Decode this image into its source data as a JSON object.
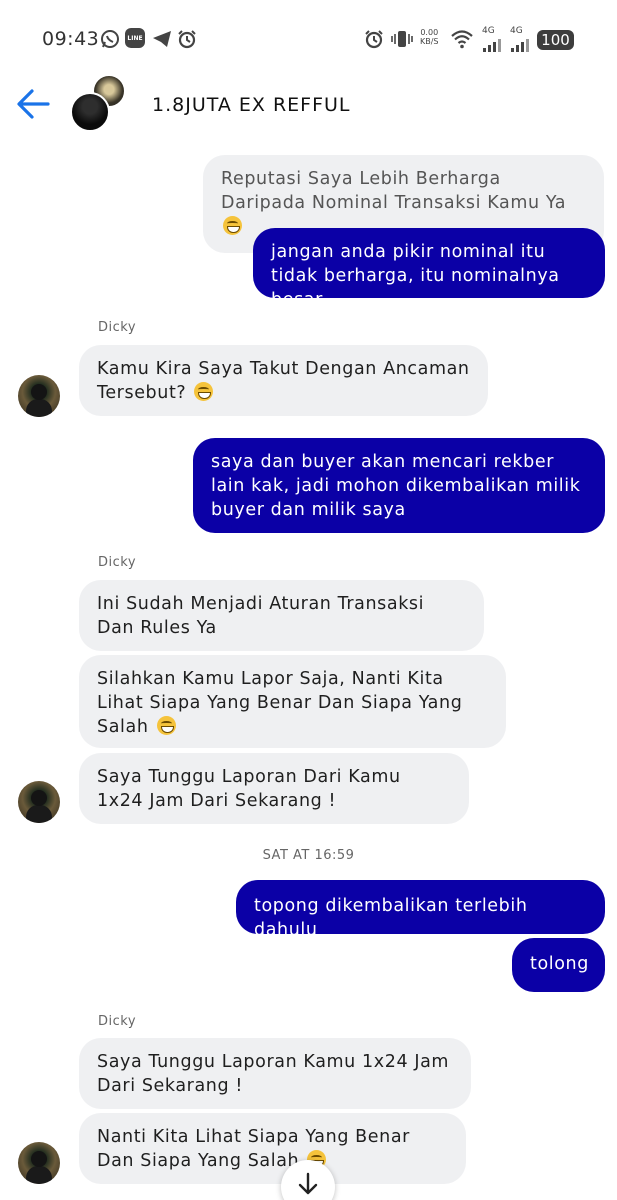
{
  "status_bar": {
    "time": "09:43",
    "battery": "100",
    "net_speed_value": "0.00",
    "net_speed_unit": "KB/S",
    "network_1": "4G",
    "network_2": "4G"
  },
  "header": {
    "title": "1.8JUTA EX REFFUL"
  },
  "messages": {
    "m0_quoted": "Reputasi Saya Lebih Berharga Daripada Nominal Transaksi Kamu Ya",
    "m1": "jangan anda pikir nominal itu tidak berharga, itu nominalnya besar",
    "sender_1": "Dicky",
    "m2": "Kamu Kira Saya Takut Dengan Ancaman Tersebut?",
    "m3": "saya dan buyer akan mencari rekber lain kak, jadi mohon dikembalikan milik buyer dan milik saya",
    "sender_2": "Dicky",
    "m4": "Ini Sudah Menjadi Aturan Transaksi Dan Rules Ya",
    "m5": "Silahkan Kamu Lapor Saja, Nanti Kita Lihat Siapa Yang Benar Dan Siapa Yang Salah",
    "m6": "Saya Tunggu Laporan Dari Kamu 1x24 Jam Dari Sekarang !",
    "timestamp": "SAT AT 16:59",
    "m7": "topong dikembalikan terlebih dahulu",
    "m8": "tolong",
    "sender_3": "Dicky",
    "m9": "Saya Tunggu Laporan Kamu 1x24 Jam Dari Sekarang !",
    "m10": "Nanti Kita Lihat Siapa Yang Benar Dan Siapa Yang Salah"
  },
  "colors": {
    "outgoing_bubble": "#0b00a6",
    "incoming_bubble": "#eff0f2",
    "back_arrow": "#1a73e8"
  },
  "icons": [
    "whatsapp-icon",
    "line-icon",
    "telegram-icon",
    "alarm-icon",
    "vibrate-icon",
    "wifi-icon",
    "signal-icon",
    "battery-icon",
    "back-arrow-icon",
    "grin-emoji-icon",
    "arrow-down-icon"
  ]
}
